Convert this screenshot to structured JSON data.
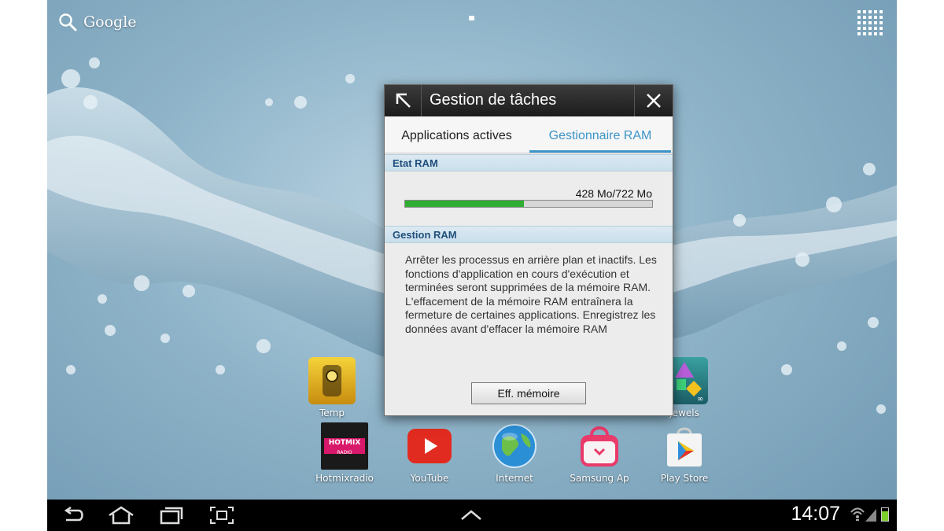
{
  "home": {
    "google_label": "Google",
    "apps_row_top": [
      {
        "label": "Temp",
        "icon": "temple-run-icon"
      },
      {
        "label": "Jewels",
        "icon": "jewels-icon"
      }
    ],
    "apps_row_bottom": [
      {
        "label": "Hotmixradio",
        "icon": "hotmix-icon",
        "badge": "HOTMIX",
        "badge_sub": "RADIO"
      },
      {
        "label": "YouTube",
        "icon": "youtube-icon"
      },
      {
        "label": "Internet",
        "icon": "internet-globe-icon"
      },
      {
        "label": "Samsung Ap",
        "icon": "samsung-apps-icon"
      },
      {
        "label": "Play Store",
        "icon": "play-store-icon"
      }
    ]
  },
  "dialog": {
    "title": "Gestion de tâches",
    "tabs": [
      {
        "label": "Applications actives",
        "active": false
      },
      {
        "label": "Gestionnaire RAM",
        "active": true
      }
    ],
    "ram_state_header": "Etat RAM",
    "ram_usage_text": "428 Mo/722 Mo",
    "ram_used_fraction": 0.48,
    "ram_manage_header": "Gestion RAM",
    "description": "Arrêter les processus en arrière plan et inactifs. Les fonctions d'application en cours d'exécution et terminées seront supprimées de la mémoire RAM. L'effacement de la mémoire RAM entraînera la fermeture de certaines applications. Enregistrez les données avant d'effacer la mémoire RAM",
    "clear_button": "Eff. mémoire"
  },
  "navbar": {
    "clock": "14:07"
  },
  "colors": {
    "accent_tab": "#3e94c8",
    "ram_bar": "#2fae32",
    "battery": "#7cd12b"
  }
}
